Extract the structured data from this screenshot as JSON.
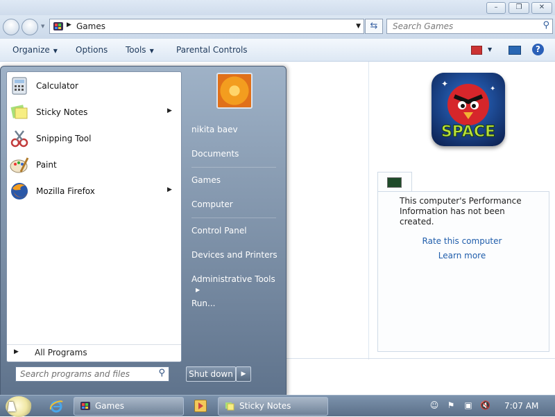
{
  "window": {
    "caption_buttons": {
      "minimize": "–",
      "restore": "❐",
      "close": "✕"
    },
    "address": {
      "location": "Games"
    },
    "search": {
      "placeholder": "Search Games"
    },
    "commands": [
      {
        "label": "Organize",
        "has_dropdown": true
      },
      {
        "label": "Options",
        "has_dropdown": false
      },
      {
        "label": "Tools",
        "has_dropdown": true
      },
      {
        "label": "Parental Controls",
        "has_dropdown": false
      }
    ],
    "preview": {
      "game_logo_text": "SPACE",
      "perf_text": "This computer's Performance Information has not been created.",
      "rate_link": "Rate this computer",
      "learn_link": "Learn more"
    }
  },
  "start_menu": {
    "programs": [
      {
        "label": "Calculator",
        "icon": "calculator-icon",
        "submenu": false
      },
      {
        "label": "Sticky Notes",
        "icon": "sticky-notes-icon",
        "submenu": true
      },
      {
        "label": "Snipping Tool",
        "icon": "snipping-tool-icon",
        "submenu": false
      },
      {
        "label": "Paint",
        "icon": "paint-icon",
        "submenu": false
      },
      {
        "label": "Mozilla Firefox",
        "icon": "firefox-icon",
        "submenu": true
      }
    ],
    "all_programs": "All Programs",
    "search_placeholder": "Search programs and files",
    "user": "nikita baev",
    "right_items": [
      "Documents",
      "Games",
      "Computer",
      "Control Panel",
      "Devices and Printers",
      "Administrative Tools",
      "Run..."
    ],
    "shutdown": "Shut down"
  },
  "taskbar": {
    "buttons": [
      {
        "label": "Games",
        "icon": "games-icon"
      },
      {
        "label": "Sticky Notes",
        "icon": "sticky-notes-icon"
      }
    ],
    "clock": "7:07 AM"
  }
}
